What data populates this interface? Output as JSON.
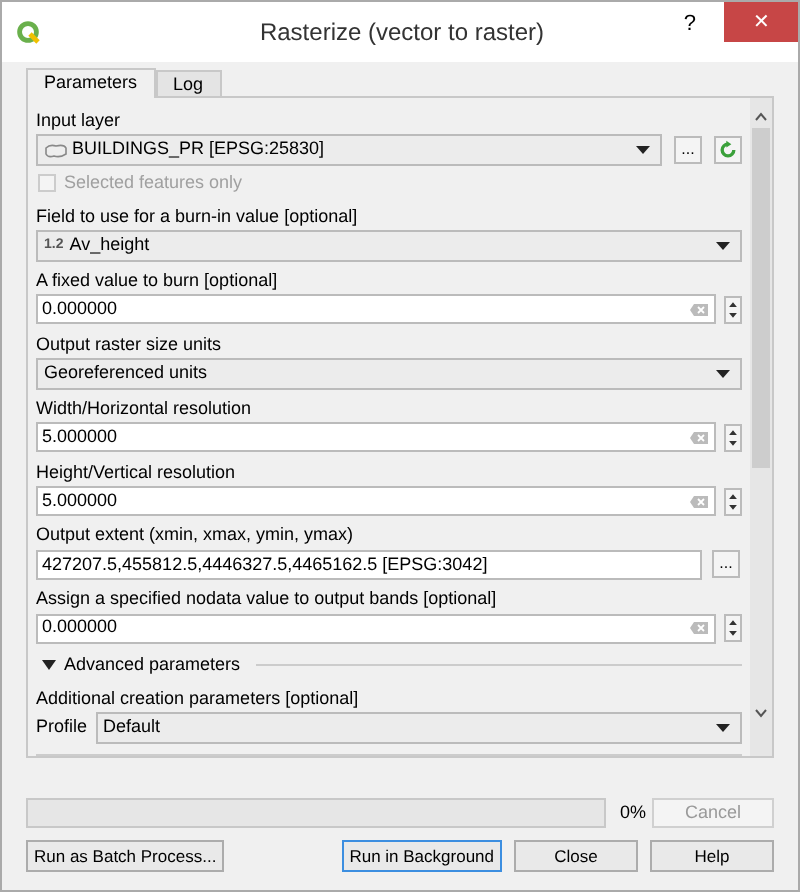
{
  "window": {
    "title": "Rasterize (vector to raster)",
    "help": "?",
    "close": "✕"
  },
  "tabs": [
    {
      "label": "Parameters",
      "selected": true
    },
    {
      "label": "Log",
      "selected": false
    }
  ],
  "parameters": [
    {
      "kind": "label",
      "text": "Input layer"
    },
    {
      "kind": "layer",
      "value": "BUILDINGS_PR [EPSG:25830]",
      "browse": "..."
    },
    {
      "kind": "checkbox",
      "label": "Selected features only",
      "checked": false,
      "disabled": true
    },
    {
      "kind": "label",
      "text": "Field to use for a burn-in value [optional]"
    },
    {
      "kind": "field_combo",
      "type_tag": "1.2",
      "value": "Av_height"
    },
    {
      "kind": "label",
      "text": "A fixed value to burn [optional]"
    },
    {
      "kind": "spin",
      "value": "0.000000"
    },
    {
      "kind": "label",
      "text": "Output raster size units"
    },
    {
      "kind": "combo",
      "value": "Georeferenced units"
    },
    {
      "kind": "label",
      "text": "Width/Horizontal resolution"
    },
    {
      "kind": "spin",
      "value": "5.000000"
    },
    {
      "kind": "label",
      "text": "Height/Vertical resolution"
    },
    {
      "kind": "spin",
      "value": "5.000000"
    },
    {
      "kind": "label",
      "text": "Output extent (xmin, xmax, ymin, ymax)"
    },
    {
      "kind": "extent",
      "value": "427207.5,455812.5,4446327.5,4465162.5 [EPSG:3042]",
      "browse": "..."
    },
    {
      "kind": "label",
      "text": "Assign a specified nodata value to output bands [optional]"
    },
    {
      "kind": "spin",
      "value": "0.000000"
    },
    {
      "kind": "section",
      "text": "Advanced parameters",
      "expanded": true
    },
    {
      "kind": "label",
      "text": "Additional creation parameters [optional]"
    },
    {
      "kind": "profile",
      "label": "Profile",
      "value": "Default"
    }
  ],
  "progress": {
    "level": 0,
    "reading": "0%",
    "cancel": "Cancel"
  },
  "buttons": [
    {
      "label": "Run as Batch Process...",
      "kind": "left",
      "focused": false
    },
    {
      "label": "Run in Background",
      "kind": "right",
      "focused": true
    },
    {
      "label": "Close",
      "kind": "right",
      "focused": false
    },
    {
      "label": "Help",
      "kind": "right",
      "focused": false
    }
  ]
}
